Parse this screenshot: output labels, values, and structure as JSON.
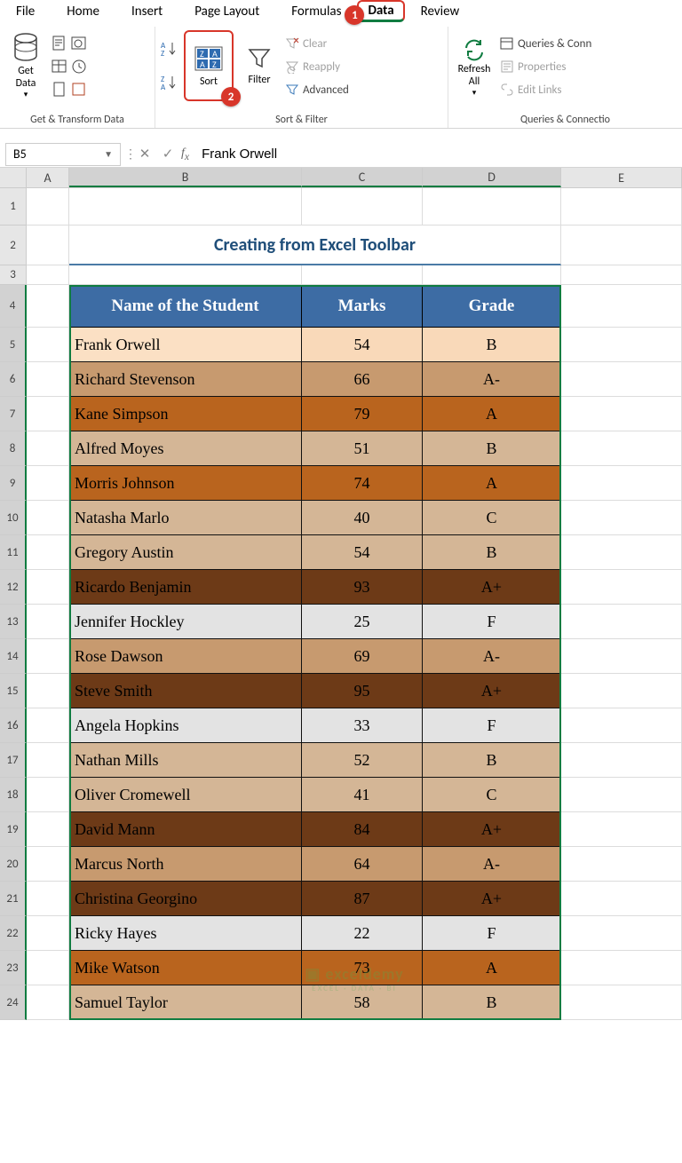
{
  "tabs": [
    "File",
    "Home",
    "Insert",
    "Page Layout",
    "Formulas",
    "Data",
    "Review"
  ],
  "active_tab": "Data",
  "callouts": {
    "tab": "1",
    "sort": "2"
  },
  "ribbon": {
    "get_data": "Get\nData",
    "group1": "Get & Transform Data",
    "sort_asc_tip": "A→Z",
    "sort_desc_tip": "Z→A",
    "sort": "Sort",
    "filter": "Filter",
    "clear": "Clear",
    "reapply": "Reapply",
    "advanced": "Advanced",
    "group2": "Sort & Filter",
    "refresh": "Refresh\nAll",
    "queries": "Queries & Conn",
    "properties": "Properties",
    "editlinks": "Edit Links",
    "group3": "Queries & Connectio"
  },
  "namebox": "B5",
  "formula": "Frank Orwell",
  "columns": [
    "A",
    "B",
    "C",
    "D",
    "E"
  ],
  "title": "Creating from Excel Toolbar",
  "headers": [
    "Name of the Student",
    "Marks",
    "Grade"
  ],
  "row_heights": {
    "r1": 42,
    "r2": 45,
    "r3": 22,
    "r4": 48,
    "data": 39
  },
  "students": [
    {
      "name": "Frank Orwell",
      "marks": "54",
      "grade": "B",
      "tint": "#f9d9b9",
      "active": true
    },
    {
      "name": "Richard Stevenson",
      "marks": "66",
      "grade": "A-",
      "tint": "#c79a6f"
    },
    {
      "name": "Kane Simpson",
      "marks": "79",
      "grade": "A",
      "tint": "#b9641e"
    },
    {
      "name": "Alfred Moyes",
      "marks": "51",
      "grade": "B",
      "tint": "#d4b696"
    },
    {
      "name": "Morris Johnson",
      "marks": "74",
      "grade": "A",
      "tint": "#b9641e"
    },
    {
      "name": "Natasha Marlo",
      "marks": "40",
      "grade": "C",
      "tint": "#d4b696"
    },
    {
      "name": "Gregory Austin",
      "marks": "54",
      "grade": "B",
      "tint": "#d4b696"
    },
    {
      "name": "Ricardo Benjamin",
      "marks": "93",
      "grade": "A+",
      "tint": "#6d3a17"
    },
    {
      "name": "Jennifer Hockley",
      "marks": "25",
      "grade": "F",
      "tint": "#e3e3e3"
    },
    {
      "name": "Rose Dawson",
      "marks": "69",
      "grade": "A-",
      "tint": "#c79a6f"
    },
    {
      "name": "Steve Smith",
      "marks": "95",
      "grade": "A+",
      "tint": "#6d3a17"
    },
    {
      "name": "Angela Hopkins",
      "marks": "33",
      "grade": "F",
      "tint": "#e3e3e3"
    },
    {
      "name": "Nathan Mills",
      "marks": "52",
      "grade": "B",
      "tint": "#d4b696"
    },
    {
      "name": "Oliver Cromewell",
      "marks": "41",
      "grade": "C",
      "tint": "#d4b696"
    },
    {
      "name": "David Mann",
      "marks": "84",
      "grade": "A+",
      "tint": "#6d3a17"
    },
    {
      "name": "Marcus North",
      "marks": "64",
      "grade": "A-",
      "tint": "#c79a6f"
    },
    {
      "name": "Christina Georgino",
      "marks": "87",
      "grade": "A+",
      "tint": "#6d3a17"
    },
    {
      "name": "Ricky Hayes",
      "marks": "22",
      "grade": "F",
      "tint": "#e3e3e3"
    },
    {
      "name": "Mike Watson",
      "marks": "73",
      "grade": "A",
      "tint": "#b9641e"
    },
    {
      "name": "Samuel Taylor",
      "marks": "58",
      "grade": "B",
      "tint": "#d4b696"
    }
  ],
  "watermark": "exceldemy",
  "watermark_sub": "EXCEL · DATA · BI"
}
